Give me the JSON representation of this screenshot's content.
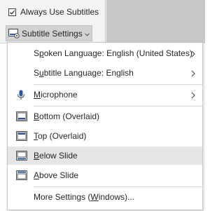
{
  "ribbon": {
    "always_use_subtitles": {
      "label": "Always Use Subtitles",
      "checked": true
    },
    "subtitle_settings": {
      "label": "Subtitle Settings",
      "icon": "subtitle-settings-icon"
    }
  },
  "menu": {
    "spoken_language": {
      "pre": "S",
      "u": "p",
      "post": "oken Language: English (United States)",
      "has_submenu": true
    },
    "subtitle_language": {
      "pre": "S",
      "u": "u",
      "post": "btitle Language: English",
      "has_submenu": true
    },
    "microphone": {
      "pre": "",
      "u": "M",
      "post": "icrophone",
      "icon": "microphone-icon",
      "has_submenu": true
    },
    "bottom_overlaid": {
      "pre": "",
      "u": "B",
      "post": "ottom (Overlaid)",
      "icon": "bottom-overlaid-icon"
    },
    "top_overlaid": {
      "pre": "",
      "u": "T",
      "post": "op (Overlaid)",
      "icon": "top-overlaid-icon"
    },
    "below_slide": {
      "pre": "",
      "u": "B",
      "post": "elow Slide",
      "icon": "below-slide-icon",
      "selected": true
    },
    "above_slide": {
      "pre": "",
      "u": "A",
      "post": "bove Slide",
      "icon": "above-slide-icon"
    },
    "more_settings": {
      "pre": "More Settings (",
      "u": "W",
      "post": "indows)..."
    }
  },
  "colors": {
    "accent_blue": "#2b579a",
    "selected_bg": "#e5e5e5",
    "text": "#262626"
  }
}
